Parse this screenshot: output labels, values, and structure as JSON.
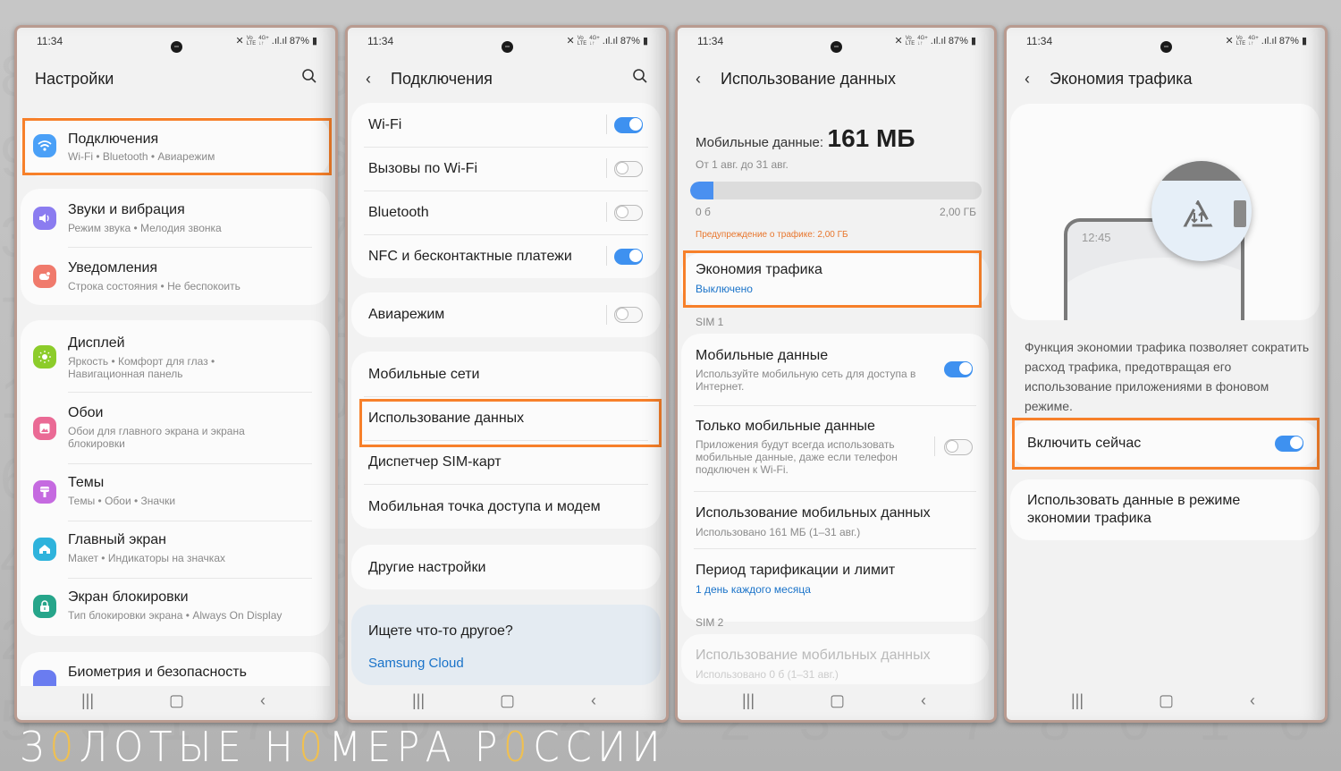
{
  "status": {
    "time": "11:34",
    "battery": "87%",
    "network": "VoLTE1 4G+",
    "signal": "signal-icons"
  },
  "screen1": {
    "title": "Настройки",
    "items": [
      {
        "icon": "wifi-icon",
        "color": "#4aa0f7",
        "title": "Подключения",
        "subtitle": "Wi-Fi  •  Bluetooth  •  Авиарежим"
      },
      {
        "icon": "sound-icon",
        "color": "#8b7cf0",
        "title": "Звуки и вибрация",
        "subtitle": "Режим звука  •  Мелодия звонка"
      },
      {
        "icon": "notifications-icon",
        "color": "#f07a6c",
        "title": "Уведомления",
        "subtitle": "Строка состояния  •  Не беспокоить"
      },
      {
        "icon": "display-icon",
        "color": "#8ccc2a",
        "title": "Дисплей",
        "subtitle": "Яркость  •  Комфорт для глаз  •  Навигационная панель"
      },
      {
        "icon": "wallpaper-icon",
        "color": "#ea6a95",
        "title": "Обои",
        "subtitle": "Обои для главного экрана и экрана блокировки"
      },
      {
        "icon": "themes-icon",
        "color": "#c56ae0",
        "title": "Темы",
        "subtitle": "Темы  •  Обои  •  Значки"
      },
      {
        "icon": "home-icon",
        "color": "#2fb3dc",
        "title": "Главный экран",
        "subtitle": "Макет  •  Индикаторы на значках"
      },
      {
        "icon": "lock-icon",
        "color": "#26a58a",
        "title": "Экран блокировки",
        "subtitle": "Тип блокировки экрана  •  Always On Display"
      },
      {
        "icon": "biometrics-icon",
        "color": "#6a7cf0",
        "title": "Биометрия и безопасность",
        "subtitle": ""
      }
    ]
  },
  "screen2": {
    "title": "Подключения",
    "items": [
      {
        "title": "Wi-Fi",
        "toggle": true
      },
      {
        "title": "Вызовы по Wi-Fi",
        "toggle": false
      },
      {
        "title": "Bluetooth",
        "toggle": false
      },
      {
        "title": "NFC и бесконтактные платежи",
        "toggle": true
      },
      {
        "title": "Авиарежим",
        "toggle": false
      },
      {
        "title": "Мобильные сети"
      },
      {
        "title": "Использование данных"
      },
      {
        "title": "Диспетчер SIM-карт"
      },
      {
        "title": "Мобильная точка доступа и модем"
      },
      {
        "title": "Другие настройки"
      }
    ],
    "suggest_title": "Ищете что-то другое?",
    "suggest_link": "Samsung Cloud"
  },
  "screen3": {
    "title": "Использование данных",
    "mobile_label": "Мобильные данные:",
    "mobile_value": "161 МБ",
    "period": "От 1 авг. до 31 авг.",
    "usage_fraction": 0.08,
    "bar_min": "0 б",
    "bar_max": "2,00 ГБ",
    "warning": "Предупреждение о трафике: 2,00 ГБ",
    "saver_title": "Экономия трафика",
    "saver_status": "Выключено",
    "sim1": "SIM 1",
    "sim1_items": [
      {
        "title": "Мобильные данные",
        "subtitle": "Используйте мобильную сеть для доступа в Интернет.",
        "toggle": true
      },
      {
        "title": "Только мобильные данные",
        "subtitle": "Приложения будут всегда использовать мобильные данные, даже если телефон подключен к Wi-Fi.",
        "toggle": false
      },
      {
        "title": "Использование мобильных данных",
        "subtitle": "Использовано 161 МБ (1–31 авг.)"
      },
      {
        "title": "Период тарификации и лимит",
        "subtitle": "1 день каждого месяца"
      }
    ],
    "sim2": "SIM 2",
    "sim2_items": [
      {
        "title": "Использование мобильных данных",
        "subtitle": "Использовано 0 б (1–31 авг.)"
      }
    ]
  },
  "screen4": {
    "title": "Экономия трафика",
    "illustration_time": "12:45",
    "description": "Функция экономии трафика позволяет сократить расход трафика, предотвращая его использование приложениями в фоновом режиме.",
    "enable_label": "Включить сейчас",
    "enable_toggle": true,
    "use_data_label": "Использовать данные в режиме экономии трафика"
  },
  "watermark": {
    "parts": [
      "З",
      "0",
      "ЛОТЫЕ Н",
      "0",
      "МЕРА Р",
      "0",
      "ССИИ"
    ]
  },
  "colors": {
    "highlight": "#f7802a",
    "accent": "#3e91f0",
    "link": "#1a73c9",
    "warning": "#e8762d"
  }
}
